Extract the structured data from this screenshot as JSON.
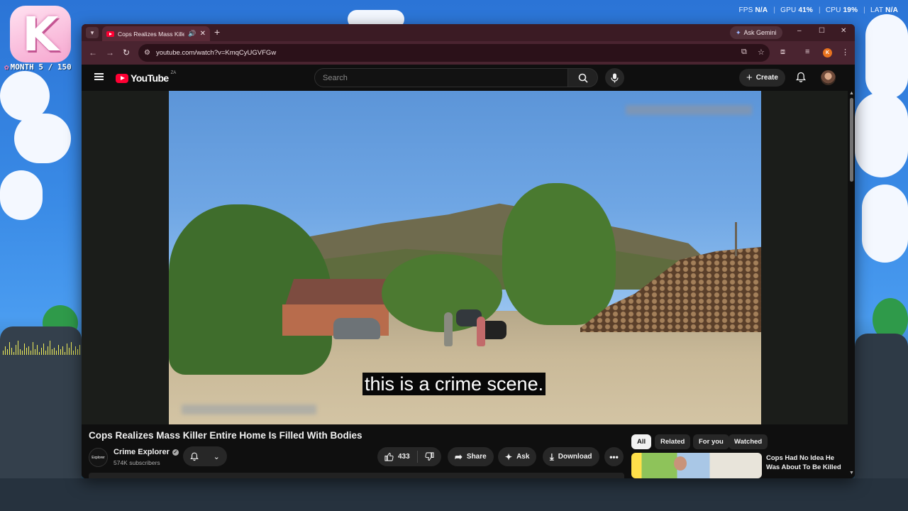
{
  "desktop": {
    "brand_letter": "K",
    "month_label": "MONTH 5 / 150",
    "stats": {
      "fps_label": "FPS",
      "fps_value": "N/A",
      "gpu_label": "GPU",
      "gpu_value": "41%",
      "cpu_label": "CPU",
      "cpu_value": "19%",
      "lat_label": "LAT",
      "lat_value": "N/A"
    },
    "eq_levels": [
      0.3,
      0.6,
      0.4,
      0.9,
      0.5,
      0.2,
      0.7,
      1.0,
      0.4,
      0.3,
      0.8,
      0.5,
      0.6,
      0.3,
      0.9,
      0.4,
      0.7,
      0.2,
      0.5,
      0.8,
      0.3,
      0.6,
      1.0,
      0.4,
      0.5,
      0.3,
      0.7,
      0.4,
      0.6,
      0.2,
      0.8,
      0.5,
      0.9,
      0.3,
      0.6,
      0.4,
      0.7,
      0.3
    ]
  },
  "browser": {
    "tab": {
      "title": "Cops Realizes Mass Killer Entire Home Is Filled With Bodies",
      "audio_icon": "speaker-icon"
    },
    "new_tab_label": "+",
    "gemini_label": "Ask Gemini",
    "window_controls": {
      "minimize": "–",
      "maximize": "☐",
      "close": "✕"
    },
    "url": "youtube.com/watch?v=KmqCyUGVFGw",
    "profile_initial": "K"
  },
  "youtube": {
    "logo_text": "YouTube",
    "country_code": "ZA",
    "search_placeholder": "Search",
    "create_label": "Create",
    "subtitle": "this is a crime scene.",
    "video_title": "Cops Realizes Mass Killer Entire Home Is Filled With Bodies",
    "channel": {
      "name": "Crime Explorer",
      "avatar_text": "Explorer",
      "subscribers": "574K subscribers"
    },
    "actions": {
      "like_count": "433",
      "share_label": "Share",
      "ask_label": "Ask",
      "download_label": "Download",
      "more_label": "•••"
    },
    "chips": [
      "All",
      "Related",
      "For you",
      "Watched"
    ],
    "recommended": [
      {
        "title": "Cops Had No Idea He Was About To Be Killed"
      }
    ]
  }
}
